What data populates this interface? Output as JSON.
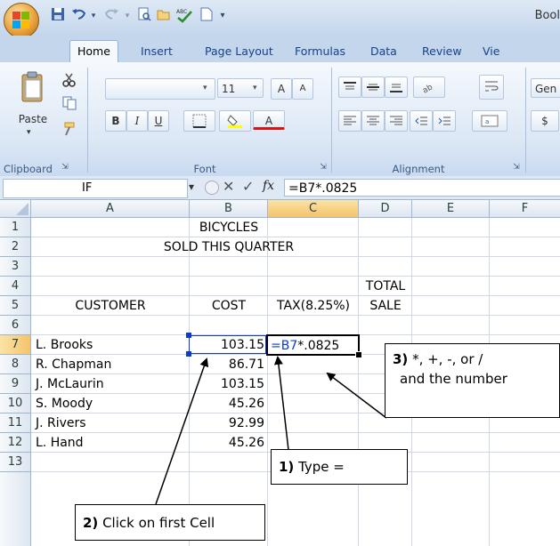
{
  "window": {
    "title_fragment": "Bool",
    "quick_access": {
      "save_icon": "save-icon",
      "undo_icon": "undo-icon",
      "redo_icon": "redo-icon",
      "print_preview_icon": "print-preview-icon",
      "spelling_icon": "spelling-icon"
    }
  },
  "tabs": [
    "Home",
    "Insert",
    "Page Layout",
    "Formulas",
    "Data",
    "Review",
    "Vie"
  ],
  "ribbon": {
    "clipboard": {
      "label": "Clipboard",
      "paste_label": "Paste"
    },
    "font": {
      "label": "Font",
      "size": "11",
      "grow": "A",
      "shrink": "A",
      "bold": "B",
      "italic": "I",
      "underline": "U",
      "font_color": "A"
    },
    "alignment": {
      "label": "Alignment"
    },
    "number": {
      "format_fragment": "Gen",
      "currency": "$"
    }
  },
  "formula_bar": {
    "name_box": "IF",
    "cancel": "✕",
    "enter": "✓",
    "fx": "fx",
    "formula": "=B7*.0825"
  },
  "columns": [
    "A",
    "B",
    "C",
    "D",
    "E",
    "F"
  ],
  "rows": [
    "1",
    "2",
    "3",
    "4",
    "5",
    "6",
    "7",
    "8",
    "9",
    "10",
    "11",
    "12",
    "13"
  ],
  "cells": {
    "title1": "BICYCLES",
    "title2": "SOLD THIS QUARTER",
    "total": "TOTAL",
    "customer_hdr": "CUSTOMER",
    "cost_hdr": "COST",
    "tax_hdr": "TAX(8.25%)",
    "sale_hdr": "SALE",
    "data": [
      {
        "customer": "L. Brooks",
        "cost": "103.15"
      },
      {
        "customer": "R. Chapman",
        "cost": "86.71"
      },
      {
        "customer": "J. McLaurin",
        "cost": "103.15"
      },
      {
        "customer": "S. Moody",
        "cost": "45.26"
      },
      {
        "customer": "J. Rivers",
        "cost": "92.99"
      },
      {
        "customer": "L. Hand",
        "cost": "45.26"
      }
    ],
    "edit_ref": "=B7",
    "edit_rest": "*.0825"
  },
  "callouts": {
    "step1_num": "1)",
    "step1_text": " Type =",
    "step2_num": "2)",
    "step2_text": " Click on first Cell",
    "step3_num": "3)",
    "step3_line1": "  *, +, -, or /",
    "step3_line2": "and the number"
  },
  "colors": {
    "active_cell_border": "#000000",
    "reference_blue": "#0b3dc9",
    "selected_header": "#f5c36b"
  }
}
